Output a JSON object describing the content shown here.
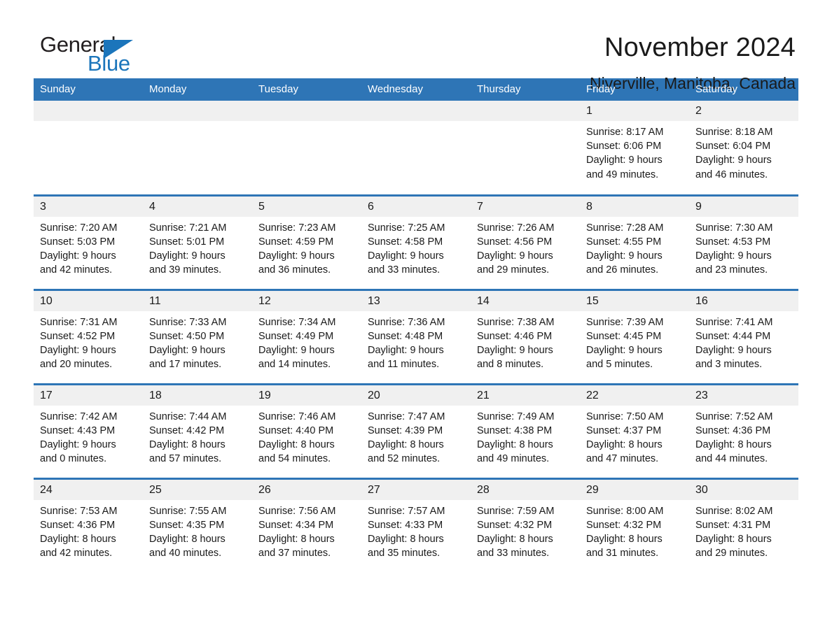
{
  "brand": {
    "name_part1": "General",
    "name_part2": "Blue",
    "accent_color": "#1b75bb"
  },
  "header": {
    "title": "November 2024",
    "location": "Niverville, Manitoba, Canada",
    "header_bar_color": "#2e75b6"
  },
  "weekdays": [
    "Sunday",
    "Monday",
    "Tuesday",
    "Wednesday",
    "Thursday",
    "Friday",
    "Saturday"
  ],
  "weeks": [
    [
      {
        "day": "",
        "sunrise": "",
        "sunset": "",
        "daylight_line1": "",
        "daylight_line2": ""
      },
      {
        "day": "",
        "sunrise": "",
        "sunset": "",
        "daylight_line1": "",
        "daylight_line2": ""
      },
      {
        "day": "",
        "sunrise": "",
        "sunset": "",
        "daylight_line1": "",
        "daylight_line2": ""
      },
      {
        "day": "",
        "sunrise": "",
        "sunset": "",
        "daylight_line1": "",
        "daylight_line2": ""
      },
      {
        "day": "",
        "sunrise": "",
        "sunset": "",
        "daylight_line1": "",
        "daylight_line2": ""
      },
      {
        "day": "1",
        "sunrise": "Sunrise: 8:17 AM",
        "sunset": "Sunset: 6:06 PM",
        "daylight_line1": "Daylight: 9 hours",
        "daylight_line2": "and 49 minutes."
      },
      {
        "day": "2",
        "sunrise": "Sunrise: 8:18 AM",
        "sunset": "Sunset: 6:04 PM",
        "daylight_line1": "Daylight: 9 hours",
        "daylight_line2": "and 46 minutes."
      }
    ],
    [
      {
        "day": "3",
        "sunrise": "Sunrise: 7:20 AM",
        "sunset": "Sunset: 5:03 PM",
        "daylight_line1": "Daylight: 9 hours",
        "daylight_line2": "and 42 minutes."
      },
      {
        "day": "4",
        "sunrise": "Sunrise: 7:21 AM",
        "sunset": "Sunset: 5:01 PM",
        "daylight_line1": "Daylight: 9 hours",
        "daylight_line2": "and 39 minutes."
      },
      {
        "day": "5",
        "sunrise": "Sunrise: 7:23 AM",
        "sunset": "Sunset: 4:59 PM",
        "daylight_line1": "Daylight: 9 hours",
        "daylight_line2": "and 36 minutes."
      },
      {
        "day": "6",
        "sunrise": "Sunrise: 7:25 AM",
        "sunset": "Sunset: 4:58 PM",
        "daylight_line1": "Daylight: 9 hours",
        "daylight_line2": "and 33 minutes."
      },
      {
        "day": "7",
        "sunrise": "Sunrise: 7:26 AM",
        "sunset": "Sunset: 4:56 PM",
        "daylight_line1": "Daylight: 9 hours",
        "daylight_line2": "and 29 minutes."
      },
      {
        "day": "8",
        "sunrise": "Sunrise: 7:28 AM",
        "sunset": "Sunset: 4:55 PM",
        "daylight_line1": "Daylight: 9 hours",
        "daylight_line2": "and 26 minutes."
      },
      {
        "day": "9",
        "sunrise": "Sunrise: 7:30 AM",
        "sunset": "Sunset: 4:53 PM",
        "daylight_line1": "Daylight: 9 hours",
        "daylight_line2": "and 23 minutes."
      }
    ],
    [
      {
        "day": "10",
        "sunrise": "Sunrise: 7:31 AM",
        "sunset": "Sunset: 4:52 PM",
        "daylight_line1": "Daylight: 9 hours",
        "daylight_line2": "and 20 minutes."
      },
      {
        "day": "11",
        "sunrise": "Sunrise: 7:33 AM",
        "sunset": "Sunset: 4:50 PM",
        "daylight_line1": "Daylight: 9 hours",
        "daylight_line2": "and 17 minutes."
      },
      {
        "day": "12",
        "sunrise": "Sunrise: 7:34 AM",
        "sunset": "Sunset: 4:49 PM",
        "daylight_line1": "Daylight: 9 hours",
        "daylight_line2": "and 14 minutes."
      },
      {
        "day": "13",
        "sunrise": "Sunrise: 7:36 AM",
        "sunset": "Sunset: 4:48 PM",
        "daylight_line1": "Daylight: 9 hours",
        "daylight_line2": "and 11 minutes."
      },
      {
        "day": "14",
        "sunrise": "Sunrise: 7:38 AM",
        "sunset": "Sunset: 4:46 PM",
        "daylight_line1": "Daylight: 9 hours",
        "daylight_line2": "and 8 minutes."
      },
      {
        "day": "15",
        "sunrise": "Sunrise: 7:39 AM",
        "sunset": "Sunset: 4:45 PM",
        "daylight_line1": "Daylight: 9 hours",
        "daylight_line2": "and 5 minutes."
      },
      {
        "day": "16",
        "sunrise": "Sunrise: 7:41 AM",
        "sunset": "Sunset: 4:44 PM",
        "daylight_line1": "Daylight: 9 hours",
        "daylight_line2": "and 3 minutes."
      }
    ],
    [
      {
        "day": "17",
        "sunrise": "Sunrise: 7:42 AM",
        "sunset": "Sunset: 4:43 PM",
        "daylight_line1": "Daylight: 9 hours",
        "daylight_line2": "and 0 minutes."
      },
      {
        "day": "18",
        "sunrise": "Sunrise: 7:44 AM",
        "sunset": "Sunset: 4:42 PM",
        "daylight_line1": "Daylight: 8 hours",
        "daylight_line2": "and 57 minutes."
      },
      {
        "day": "19",
        "sunrise": "Sunrise: 7:46 AM",
        "sunset": "Sunset: 4:40 PM",
        "daylight_line1": "Daylight: 8 hours",
        "daylight_line2": "and 54 minutes."
      },
      {
        "day": "20",
        "sunrise": "Sunrise: 7:47 AM",
        "sunset": "Sunset: 4:39 PM",
        "daylight_line1": "Daylight: 8 hours",
        "daylight_line2": "and 52 minutes."
      },
      {
        "day": "21",
        "sunrise": "Sunrise: 7:49 AM",
        "sunset": "Sunset: 4:38 PM",
        "daylight_line1": "Daylight: 8 hours",
        "daylight_line2": "and 49 minutes."
      },
      {
        "day": "22",
        "sunrise": "Sunrise: 7:50 AM",
        "sunset": "Sunset: 4:37 PM",
        "daylight_line1": "Daylight: 8 hours",
        "daylight_line2": "and 47 minutes."
      },
      {
        "day": "23",
        "sunrise": "Sunrise: 7:52 AM",
        "sunset": "Sunset: 4:36 PM",
        "daylight_line1": "Daylight: 8 hours",
        "daylight_line2": "and 44 minutes."
      }
    ],
    [
      {
        "day": "24",
        "sunrise": "Sunrise: 7:53 AM",
        "sunset": "Sunset: 4:36 PM",
        "daylight_line1": "Daylight: 8 hours",
        "daylight_line2": "and 42 minutes."
      },
      {
        "day": "25",
        "sunrise": "Sunrise: 7:55 AM",
        "sunset": "Sunset: 4:35 PM",
        "daylight_line1": "Daylight: 8 hours",
        "daylight_line2": "and 40 minutes."
      },
      {
        "day": "26",
        "sunrise": "Sunrise: 7:56 AM",
        "sunset": "Sunset: 4:34 PM",
        "daylight_line1": "Daylight: 8 hours",
        "daylight_line2": "and 37 minutes."
      },
      {
        "day": "27",
        "sunrise": "Sunrise: 7:57 AM",
        "sunset": "Sunset: 4:33 PM",
        "daylight_line1": "Daylight: 8 hours",
        "daylight_line2": "and 35 minutes."
      },
      {
        "day": "28",
        "sunrise": "Sunrise: 7:59 AM",
        "sunset": "Sunset: 4:32 PM",
        "daylight_line1": "Daylight: 8 hours",
        "daylight_line2": "and 33 minutes."
      },
      {
        "day": "29",
        "sunrise": "Sunrise: 8:00 AM",
        "sunset": "Sunset: 4:32 PM",
        "daylight_line1": "Daylight: 8 hours",
        "daylight_line2": "and 31 minutes."
      },
      {
        "day": "30",
        "sunrise": "Sunrise: 8:02 AM",
        "sunset": "Sunset: 4:31 PM",
        "daylight_line1": "Daylight: 8 hours",
        "daylight_line2": "and 29 minutes."
      }
    ]
  ]
}
